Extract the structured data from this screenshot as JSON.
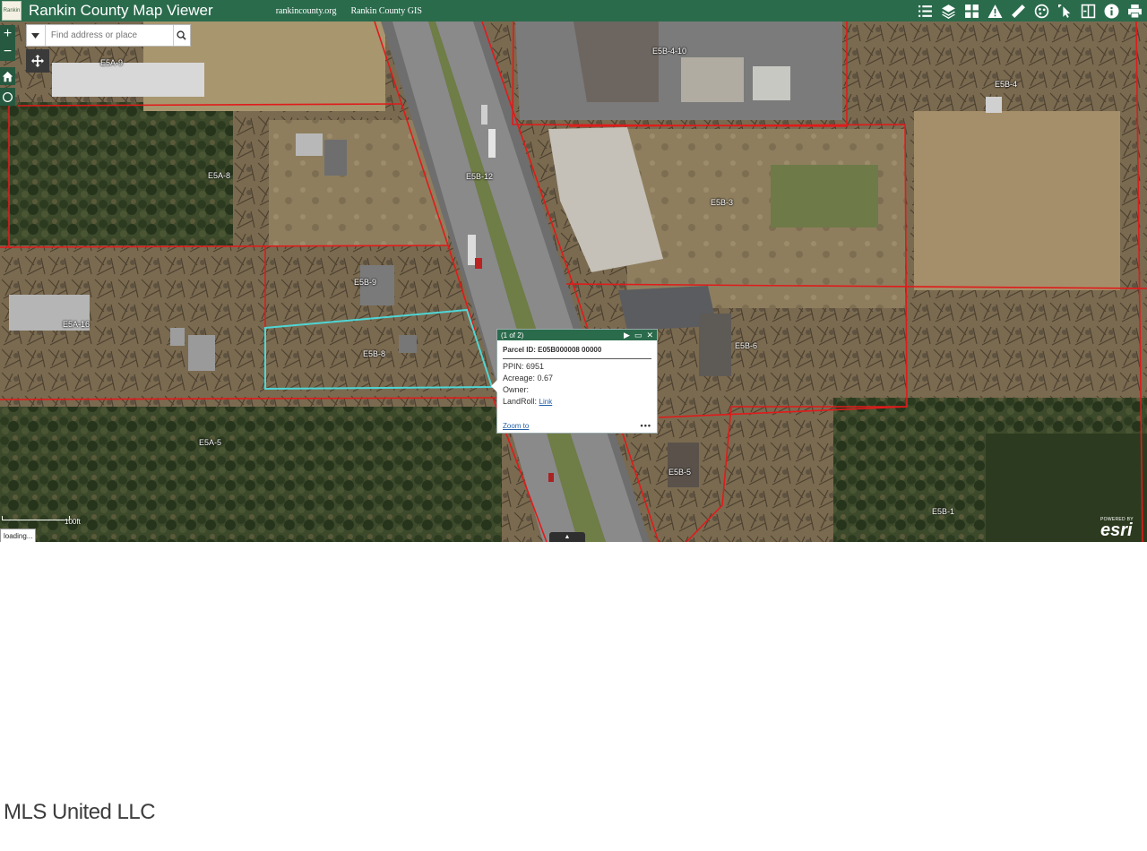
{
  "header": {
    "logo_text": "Rankin",
    "title": "Rankin County Map Viewer",
    "links": [
      "rankincounty.org",
      "Rankin County GIS"
    ],
    "toolbar_icons": [
      "legend-icon",
      "layers-icon",
      "basemap-gallery-icon",
      "warning-icon",
      "measure-icon",
      "draw-icon",
      "select-icon",
      "split-icon",
      "info-icon",
      "print-icon"
    ]
  },
  "colors": {
    "header_green": "#2a6b4c",
    "parcel_line": "#e01b1b",
    "selected_parcel": "#4fd6d6",
    "popup_header": "#2a6b4c"
  },
  "map_controls": {
    "zoom_in": "+",
    "zoom_out": "−",
    "search_placeholder": "Find address or place"
  },
  "parcel_labels": [
    {
      "id": "E5A-9"
    },
    {
      "id": "E5A-8"
    },
    {
      "id": "E5B-12"
    },
    {
      "id": "E5B-9"
    },
    {
      "id": "E5A-16"
    },
    {
      "id": "E5B-8"
    },
    {
      "id": "E5A-5"
    },
    {
      "id": "E5B-4-10"
    },
    {
      "id": "E5B-4"
    },
    {
      "id": "E5B-3"
    },
    {
      "id": "E5B-6"
    },
    {
      "id": "E5B-5"
    },
    {
      "id": "E5B-1"
    }
  ],
  "popup": {
    "counter": "(1 of 2)",
    "title": "Parcel ID: E05B000008 00000",
    "ppin": "PPIN: 6951",
    "acreage": "Acreage: 0.67",
    "owner": "Owner:",
    "landroll_label": "LandRoll:",
    "landroll_link": "Link",
    "zoom_to": "Zoom to",
    "more": "•••"
  },
  "scale": {
    "label": "100ft"
  },
  "status": {
    "text": "loading..."
  },
  "collapse_glyph": "▲",
  "attribution": {
    "powered_by": "POWERED BY",
    "name": "esri"
  },
  "watermark": "MLS United LLC"
}
